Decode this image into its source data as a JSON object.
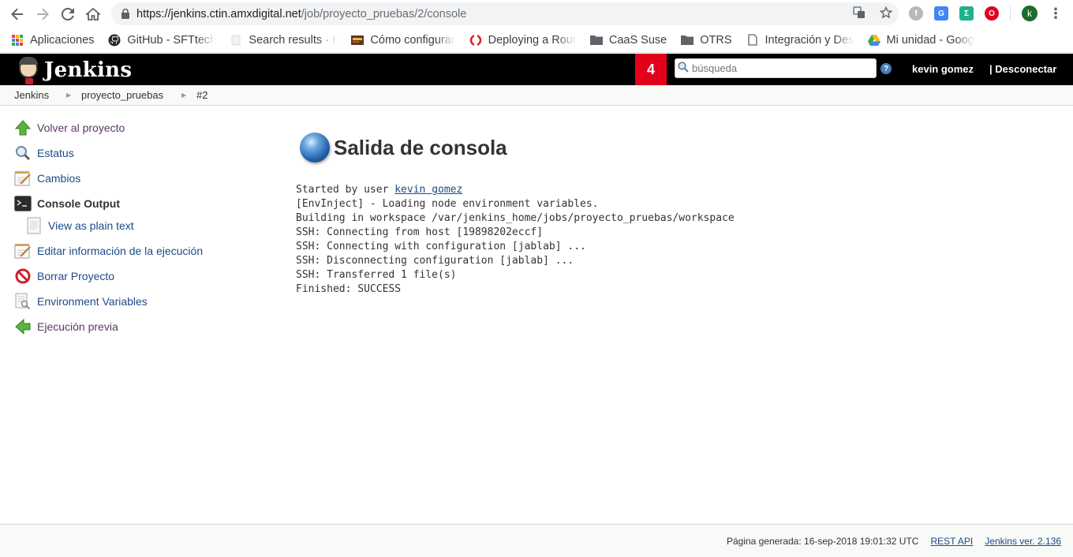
{
  "browser": {
    "url_host": "https://jenkins.ctin.amxdigital.net",
    "url_path": "/job/proyecto_pruebas/2/console",
    "bookmarks": [
      {
        "label": "Aplicaciones",
        "icon": "apps-grid-icon"
      },
      {
        "label": "GitHub - SFTtech",
        "icon": "github-icon"
      },
      {
        "label": "Search results · P",
        "icon": "page-icon"
      },
      {
        "label": "Cómo configurar",
        "icon": "site-icon"
      },
      {
        "label": "Deploying a Rout",
        "icon": "openshift-icon"
      },
      {
        "label": "CaaS Suse",
        "icon": "folder-icon"
      },
      {
        "label": "OTRS",
        "icon": "folder-icon"
      },
      {
        "label": "Integración y Des",
        "icon": "page-icon"
      },
      {
        "label": "Mi unidad - Goog",
        "icon": "drive-icon"
      }
    ],
    "avatar_letter": "k"
  },
  "jenkins": {
    "title": "Jenkins",
    "notification_count": "4",
    "search_placeholder": "búsqueda",
    "help": "?",
    "user": "kevin gomez",
    "logout": "| Desconectar",
    "breadcrumb": [
      "Jenkins",
      "proyecto_pruebas",
      "#2"
    ]
  },
  "sidebar": {
    "items": [
      {
        "label": "Volver al proyecto"
      },
      {
        "label": "Estatus"
      },
      {
        "label": "Cambios"
      },
      {
        "label": "Console Output"
      },
      {
        "label": "View as plain text"
      },
      {
        "label": "Editar información de la ejecución"
      },
      {
        "label": "Borrar Proyecto"
      },
      {
        "label": "Environment Variables"
      },
      {
        "label": "Ejecución previa"
      }
    ]
  },
  "main": {
    "title": "Salida de consola",
    "console": {
      "line1_prefix": "Started by user ",
      "line1_user": "kevin gomez",
      "lines": [
        "[EnvInject] - Loading node environment variables.",
        "Building in workspace /var/jenkins_home/jobs/proyecto_pruebas/workspace",
        "SSH: Connecting from host [19898202eccf]",
        "SSH: Connecting with configuration [jablab] ...",
        "SSH: Disconnecting configuration [jablab] ...",
        "SSH: Transferred 1 file(s)",
        "Finished: SUCCESS"
      ]
    }
  },
  "footer": {
    "generated": "Página generada: 16-sep-2018 19:01:32 UTC",
    "rest_api": "REST API",
    "version": "Jenkins ver. 2.136"
  },
  "colors": {
    "jenkins_header": "#000000",
    "badge_red": "#e3001b",
    "link_blue": "#204a87",
    "task_purple": "#5c3566"
  }
}
